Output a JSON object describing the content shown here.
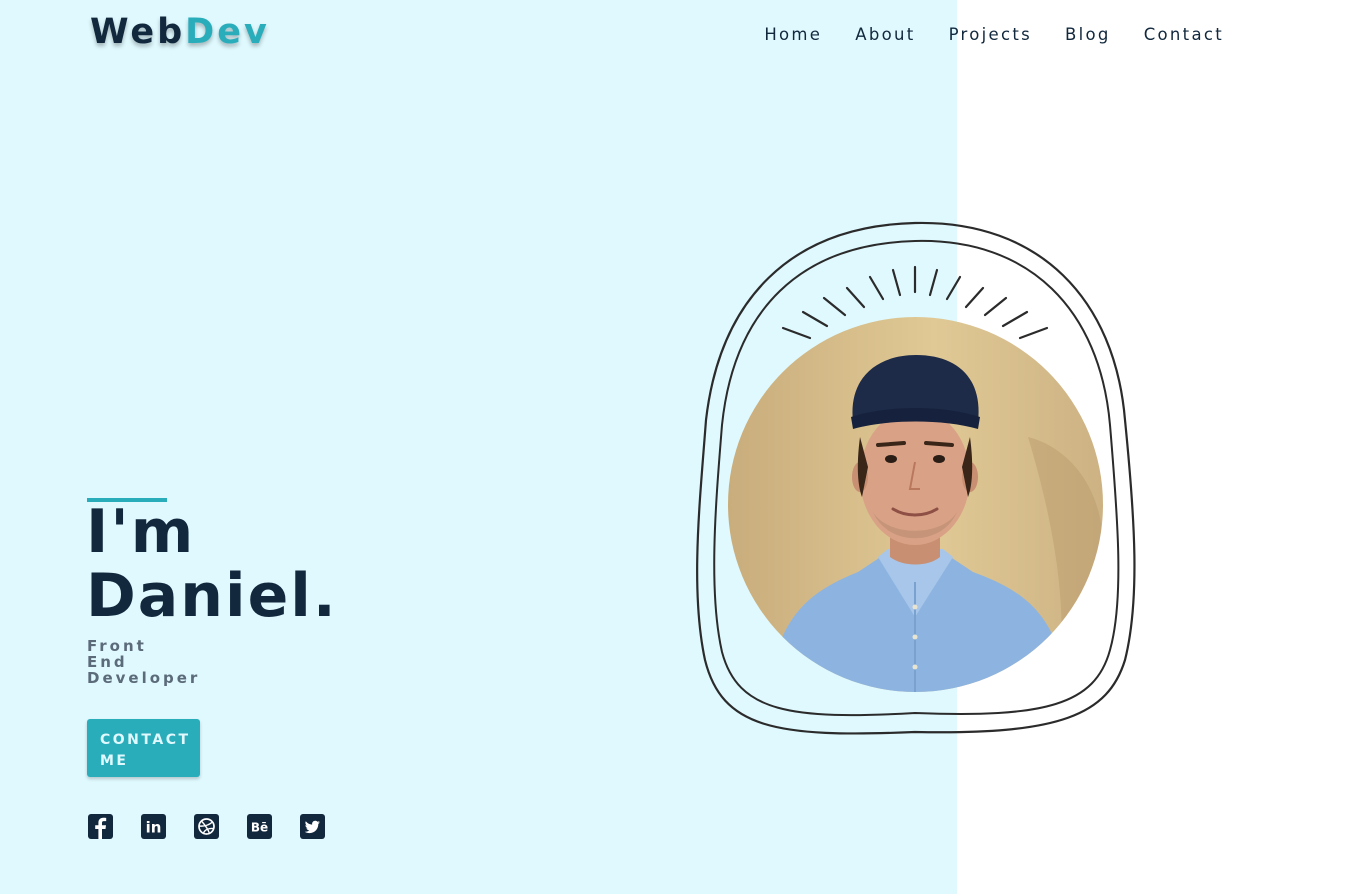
{
  "brand": {
    "name_part1": "Web",
    "name_part2": "Dev"
  },
  "nav": {
    "items": [
      "Home",
      "About",
      "Projects",
      "Blog",
      "Contact"
    ]
  },
  "intro": {
    "line1": "I'm",
    "line2": "Daniel.",
    "role_lines": [
      "Front",
      "End",
      "Developer"
    ]
  },
  "cta": {
    "line1": "CONTACT",
    "line2": "ME"
  },
  "socials": {
    "icons": [
      "facebook-icon",
      "linkedin-icon",
      "dribbble-icon",
      "behance-icon",
      "twitter-icon"
    ],
    "labels": {
      "linkedin": "in",
      "behance": "Bē"
    }
  },
  "colors": {
    "navy": "#11283d",
    "accent": "#2aadbb",
    "left_bg": "#dff9fe",
    "right_bg": "#ffffff",
    "muted": "#5b6b79"
  }
}
